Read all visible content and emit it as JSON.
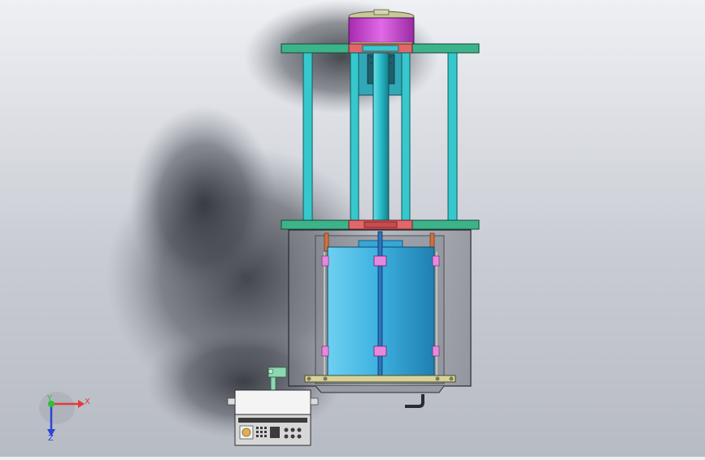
{
  "viewport": {
    "background_top": "#eef0f4",
    "background_bottom": "#b7bbc4"
  },
  "model": {
    "parts": [
      {
        "name": "motor-cap",
        "color": "#d14fd6"
      },
      {
        "name": "motor-lid",
        "color": "#c8c89a"
      },
      {
        "name": "frame-plate",
        "color": "#3db38a"
      },
      {
        "name": "frame-column",
        "color": "#36c8cc"
      },
      {
        "name": "shaft",
        "color": "#27b9c6"
      },
      {
        "name": "coupling",
        "color": "#e0676a"
      },
      {
        "name": "tank",
        "color": "#3fb3e2"
      },
      {
        "name": "baffle-block",
        "color": "#e689dd"
      },
      {
        "name": "base-plate",
        "color": "#d6d39a"
      },
      {
        "name": "housing",
        "color": "#8f9199"
      },
      {
        "name": "control-box",
        "color": "#f4f4f4"
      }
    ]
  },
  "triad": {
    "x_label": "X",
    "y_label": "Y",
    "z_label": "Z",
    "x_color": "#e23b3b",
    "y_color": "#2fbf3a",
    "z_color": "#2b45d8"
  }
}
